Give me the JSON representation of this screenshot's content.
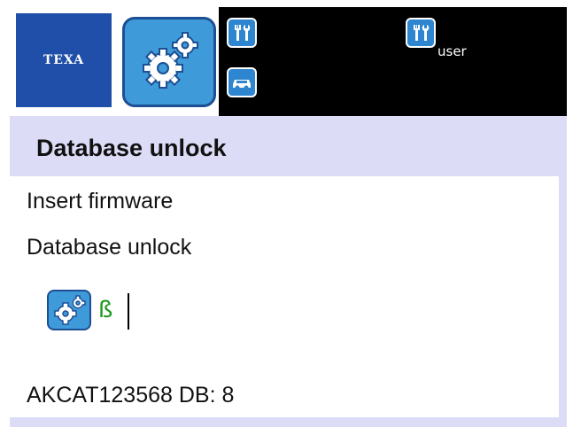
{
  "header": {
    "brand": "TEXA",
    "user_label": "user",
    "icons": [
      "settings-gears-icon",
      "tools-icon",
      "car-icon",
      "tools-icon"
    ]
  },
  "page": {
    "title": "Database unlock"
  },
  "content": {
    "line1": "Insert firmware",
    "line2": "Database unlock",
    "beta_symbol": "ß",
    "serial_info": "AKCAT123568  DB: 8"
  },
  "colors": {
    "brand_blue": "#1f4fa8",
    "icon_blue": "#3f9ad9",
    "background_lavender": "#dcdcf7",
    "beta_green": "#1c9b1c"
  }
}
